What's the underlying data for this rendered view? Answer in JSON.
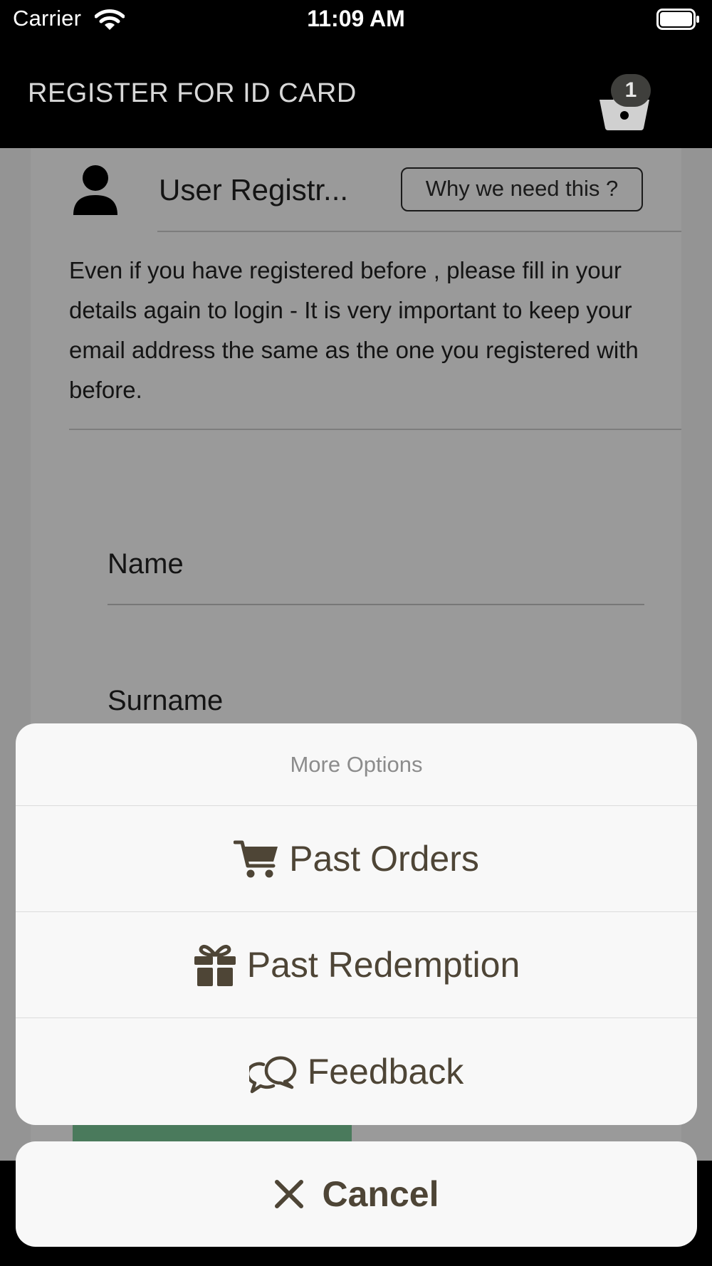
{
  "status_bar": {
    "carrier": "Carrier",
    "time": "11:09 AM"
  },
  "nav": {
    "title": "REGISTER FOR ID CARD",
    "cart_count": "1"
  },
  "registration": {
    "title": "User Registr...",
    "why_button": "Why we need this ?",
    "info": "Even if you have registered before , please fill in your details again to login - It is very important to keep your email address the same as the one you registered with before.",
    "fields": {
      "name_label": "Name",
      "surname_label": "Surname"
    }
  },
  "action_sheet": {
    "title": "More Options",
    "options": [
      {
        "label": "Past Orders",
        "icon": "cart-icon"
      },
      {
        "label": "Past Redemption",
        "icon": "gift-icon"
      },
      {
        "label": "Feedback",
        "icon": "chat-bubbles-icon"
      }
    ],
    "cancel": {
      "label": "Cancel",
      "icon": "close-icon"
    }
  },
  "colors": {
    "sheet_text": "#4e4536",
    "submit_green": "#4a7a5c",
    "overlay_gray": "#949494"
  }
}
